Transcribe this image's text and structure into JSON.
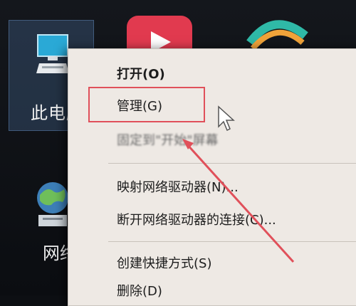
{
  "desktop": {
    "this_pc_label": "此电脑",
    "network_label": "网络"
  },
  "context_menu": {
    "open": "打开(O)",
    "manage": "管理(G)",
    "blurred_item": "固定到\"开始\"屏幕",
    "map_network_drive": "映射网络驱动器(N)...",
    "disconnect_network_drive": "断开网络驱动器的连接(C)...",
    "create_shortcut": "创建快捷方式(S)",
    "delete": "删除(D)"
  },
  "colors": {
    "menu_background": "#eee9e4",
    "highlight_box": "#e0505a",
    "annotation_arrow": "#e0505a",
    "selection": "#5a8cc8"
  },
  "icons": [
    "computer-icon",
    "network-globe-icon",
    "video-app-icon",
    "browser-app-icon",
    "mouse-cursor-icon"
  ]
}
